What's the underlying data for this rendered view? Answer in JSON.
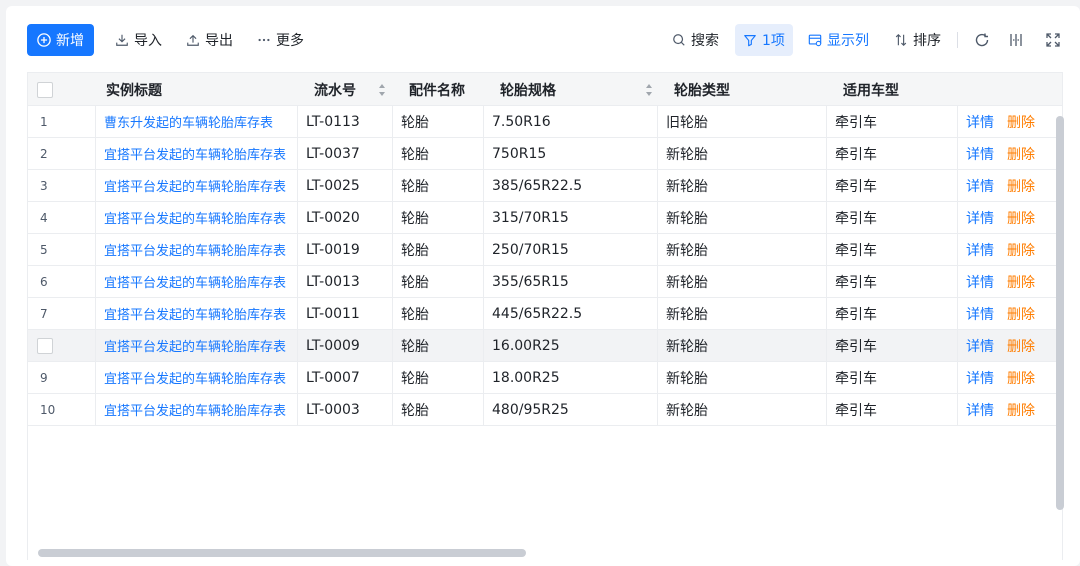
{
  "toolbar": {
    "add_label": "新增",
    "import_label": "导入",
    "export_label": "导出",
    "more_label": "更多",
    "search_label": "搜索",
    "filter_label": "1项",
    "columns_label": "显示列",
    "sort_label": "排序"
  },
  "table": {
    "headers": {
      "title": "实例标题",
      "serial": "流水号",
      "part_name": "配件名称",
      "tire_spec": "轮胎规格",
      "tire_type": "轮胎类型",
      "vehicle_type": "适用车型"
    },
    "rows": [
      {
        "index": "1",
        "title": "曹东升发起的车辆轮胎库存表",
        "serial": "LT-0113",
        "part_name": "轮胎",
        "tire_spec": "7.50R16",
        "tire_type": "旧轮胎",
        "vehicle_type": "牵引车"
      },
      {
        "index": "2",
        "title": "宜搭平台发起的车辆轮胎库存表",
        "serial": "LT-0037",
        "part_name": "轮胎",
        "tire_spec": "750R15",
        "tire_type": "新轮胎",
        "vehicle_type": "牵引车"
      },
      {
        "index": "3",
        "title": "宜搭平台发起的车辆轮胎库存表",
        "serial": "LT-0025",
        "part_name": "轮胎",
        "tire_spec": "385/65R22.5",
        "tire_type": "新轮胎",
        "vehicle_type": "牵引车"
      },
      {
        "index": "4",
        "title": "宜搭平台发起的车辆轮胎库存表",
        "serial": "LT-0020",
        "part_name": "轮胎",
        "tire_spec": "315/70R15",
        "tire_type": "新轮胎",
        "vehicle_type": "牵引车"
      },
      {
        "index": "5",
        "title": "宜搭平台发起的车辆轮胎库存表",
        "serial": "LT-0019",
        "part_name": "轮胎",
        "tire_spec": "250/70R15",
        "tire_type": "新轮胎",
        "vehicle_type": "牵引车"
      },
      {
        "index": "6",
        "title": "宜搭平台发起的车辆轮胎库存表",
        "serial": "LT-0013",
        "part_name": "轮胎",
        "tire_spec": "355/65R15",
        "tire_type": "新轮胎",
        "vehicle_type": "牵引车"
      },
      {
        "index": "7",
        "title": "宜搭平台发起的车辆轮胎库存表",
        "serial": "LT-0011",
        "part_name": "轮胎",
        "tire_spec": "445/65R22.5",
        "tire_type": "新轮胎",
        "vehicle_type": "牵引车"
      },
      {
        "index": "",
        "title": "宜搭平台发起的车辆轮胎库存表",
        "serial": "LT-0009",
        "part_name": "轮胎",
        "tire_spec": "16.00R25",
        "tire_type": "新轮胎",
        "vehicle_type": "牵引车"
      },
      {
        "index": "9",
        "title": "宜搭平台发起的车辆轮胎库存表",
        "serial": "LT-0007",
        "part_name": "轮胎",
        "tire_spec": "18.00R25",
        "tire_type": "新轮胎",
        "vehicle_type": "牵引车"
      },
      {
        "index": "10",
        "title": "宜搭平台发起的车辆轮胎库存表",
        "serial": "LT-0003",
        "part_name": "轮胎",
        "tire_spec": "480/95R25",
        "tire_type": "新轮胎",
        "vehicle_type": "牵引车"
      }
    ],
    "row_actions": {
      "detail_label": "详情",
      "delete_label": "删除"
    },
    "hovered_row": 7
  },
  "colors": {
    "primary": "#1677ff",
    "danger": "#ff7d00",
    "header_bg": "#f5f6f7"
  }
}
